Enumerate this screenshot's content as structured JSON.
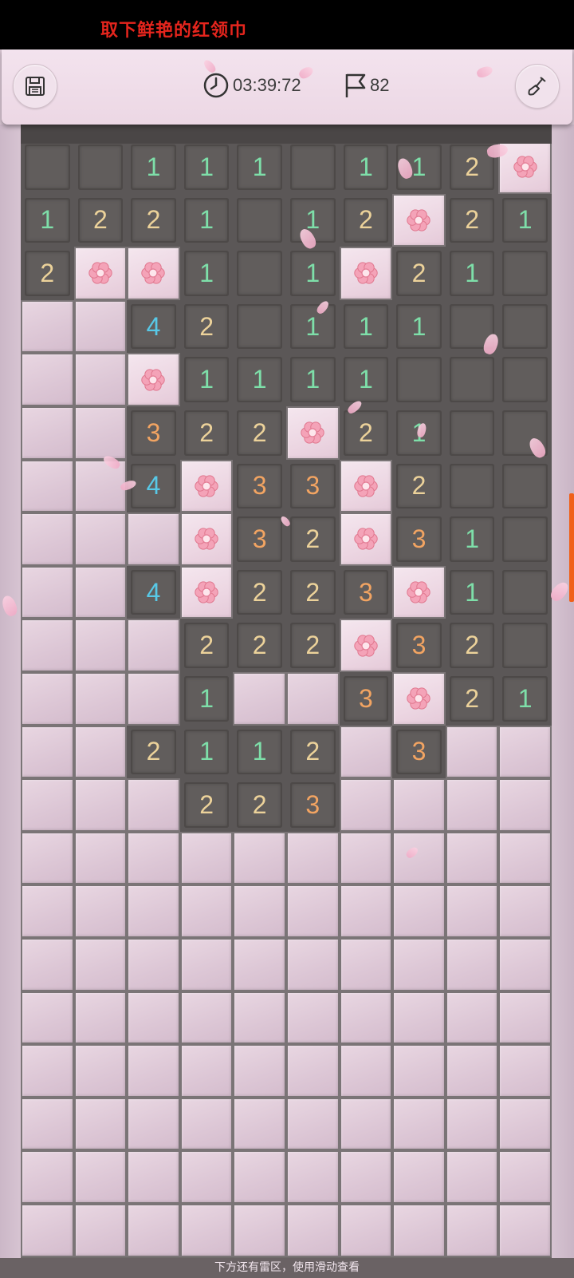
{
  "banner": {
    "text": "取下鲜艳的红领巾"
  },
  "toolbar": {
    "timer": "03:39:72",
    "flag_count": "82",
    "save_icon": "floppy-disk-icon",
    "timer_icon": "clock-icon",
    "flag_icon": "flag-icon",
    "tool_icon": "shovel-icon"
  },
  "colors": {
    "n1": "#7edfa9",
    "n2": "#ecd29a",
    "n3": "#f2a462",
    "n4": "#58c8e6",
    "accent": "#f06019",
    "banner_text": "#e5251d"
  },
  "board": {
    "columns": 10,
    "legend": "O=open empty, H=hidden, F=flower-marked, digits=open with number",
    "rows": [
      [
        "O",
        "O",
        "1",
        "1",
        "1",
        "O",
        "1",
        "1",
        "2",
        "F"
      ],
      [
        "1",
        "2",
        "2",
        "1",
        "O",
        "1",
        "2",
        "F",
        "2",
        "1"
      ],
      [
        "2",
        "F",
        "F",
        "1",
        "O",
        "1",
        "F",
        "2",
        "1",
        "O"
      ],
      [
        "H",
        "H",
        "4",
        "2",
        "O",
        "1",
        "1",
        "1",
        "O",
        "O"
      ],
      [
        "H",
        "H",
        "F",
        "1",
        "1",
        "1",
        "1",
        "O",
        "O",
        "O"
      ],
      [
        "H",
        "H",
        "3",
        "2",
        "2",
        "F",
        "2",
        "1",
        "O",
        "O"
      ],
      [
        "H",
        "H",
        "4",
        "F",
        "3",
        "3",
        "F",
        "2",
        "O",
        "O"
      ],
      [
        "H",
        "H",
        "H",
        "F",
        "3",
        "2",
        "F",
        "3",
        "1",
        "O"
      ],
      [
        "H",
        "H",
        "4",
        "F",
        "2",
        "2",
        "3",
        "F",
        "1",
        "O"
      ],
      [
        "H",
        "H",
        "H",
        "2",
        "2",
        "2",
        "F",
        "3",
        "2",
        "O"
      ],
      [
        "H",
        "H",
        "H",
        "1",
        "H",
        "H",
        "3",
        "F",
        "2",
        "1"
      ],
      [
        "H",
        "H",
        "2",
        "1",
        "1",
        "2",
        "H",
        "3",
        "H",
        "H"
      ],
      [
        "H",
        "H",
        "H",
        "2",
        "2",
        "3",
        "H",
        "H",
        "H",
        "H"
      ],
      [
        "H",
        "H",
        "H",
        "H",
        "H",
        "H",
        "H",
        "H",
        "H",
        "H"
      ],
      [
        "H",
        "H",
        "H",
        "H",
        "H",
        "H",
        "H",
        "H",
        "H",
        "H"
      ],
      [
        "H",
        "H",
        "H",
        "H",
        "H",
        "H",
        "H",
        "H",
        "H",
        "H"
      ],
      [
        "H",
        "H",
        "H",
        "H",
        "H",
        "H",
        "H",
        "H",
        "H",
        "H"
      ],
      [
        "H",
        "H",
        "H",
        "H",
        "H",
        "H",
        "H",
        "H",
        "H",
        "H"
      ],
      [
        "H",
        "H",
        "H",
        "H",
        "H",
        "H",
        "H",
        "H",
        "H",
        "H"
      ],
      [
        "H",
        "H",
        "H",
        "H",
        "H",
        "H",
        "H",
        "H",
        "H",
        "H"
      ],
      [
        "H",
        "H",
        "H",
        "H",
        "H",
        "H",
        "H",
        "H",
        "H",
        "H"
      ]
    ]
  },
  "hint": {
    "text": "下方还有雷区，使用滑动查看"
  }
}
